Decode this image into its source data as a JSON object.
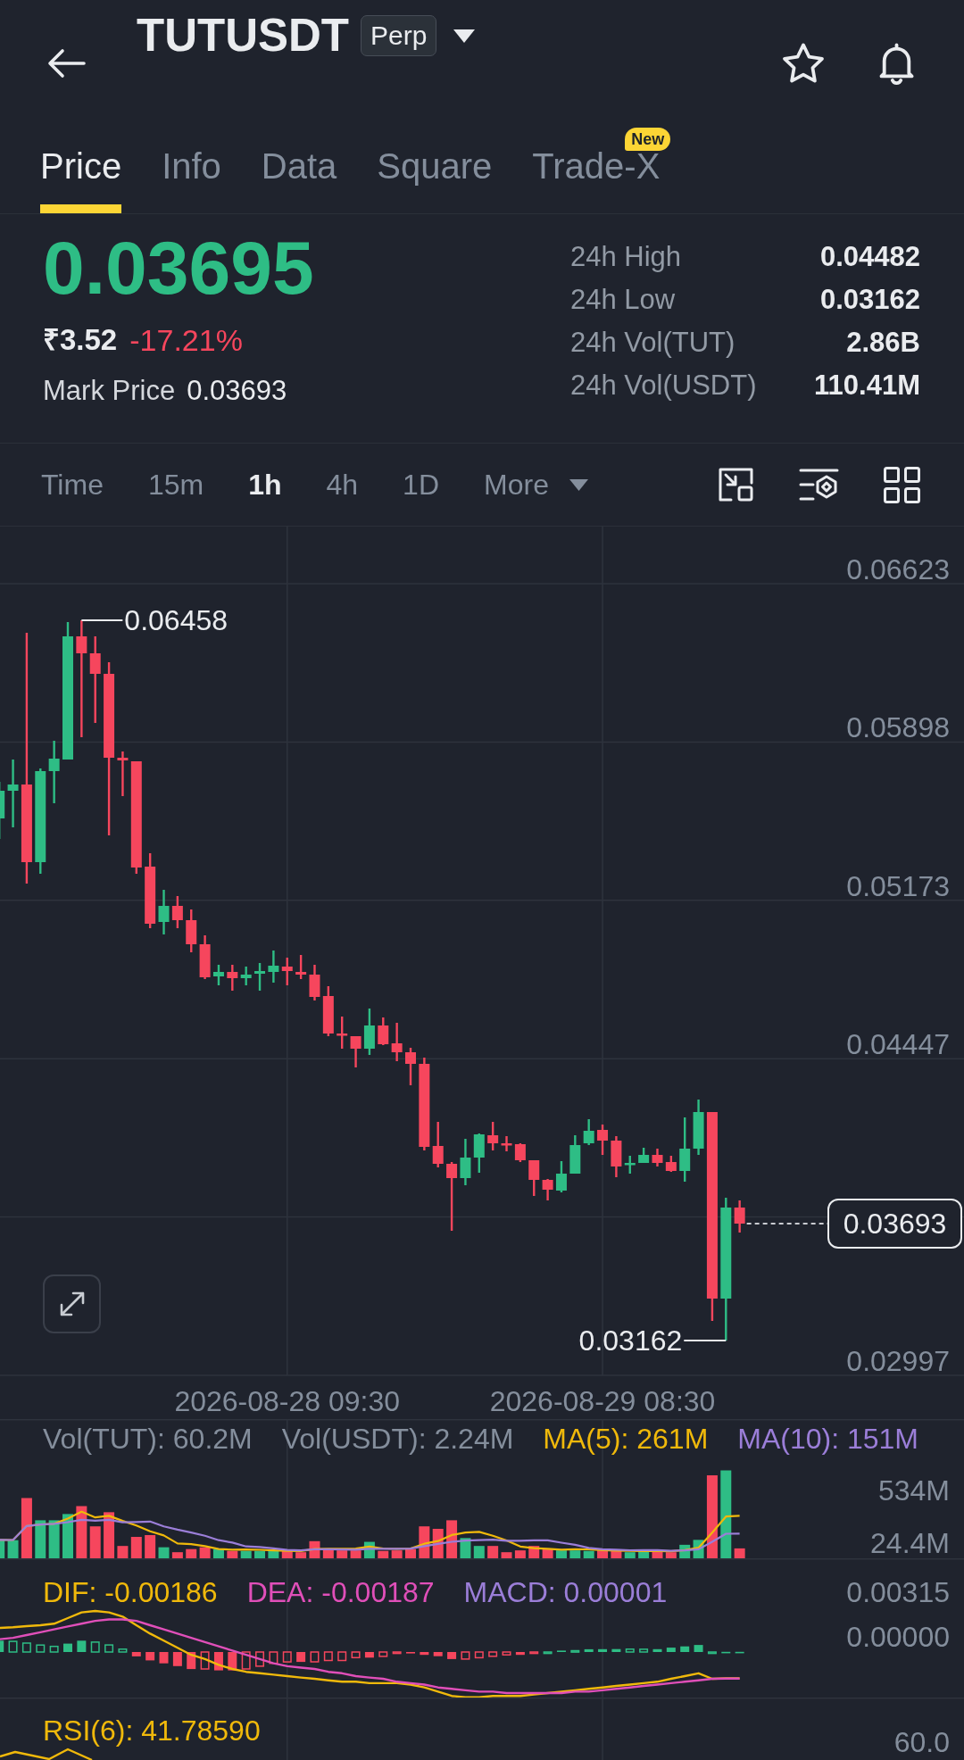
{
  "header": {
    "symbol": "TUTUSDT",
    "contract": "Perp",
    "favorite": false
  },
  "tabs": [
    {
      "label": "Price",
      "selected": true
    },
    {
      "label": "Info",
      "selected": false
    },
    {
      "label": "Data",
      "selected": false
    },
    {
      "label": "Square",
      "selected": false
    },
    {
      "label": "Trade-X",
      "selected": false,
      "badge": "New"
    }
  ],
  "ticker": {
    "last_price": "0.03695",
    "last_price_up": true,
    "fiat_price": "₹3.52",
    "change": "-17.21%",
    "change_up": false,
    "mark_price_label": "Mark Price",
    "mark_price": "0.03693",
    "stats": [
      {
        "label": "24h High",
        "value": "0.04482"
      },
      {
        "label": "24h Low",
        "value": "0.03162"
      },
      {
        "label": "24h Vol(TUT)",
        "value": "2.86B"
      },
      {
        "label": "24h Vol(USDT)",
        "value": "110.41M"
      }
    ]
  },
  "toolbar": {
    "intervals": [
      {
        "label": "Time",
        "selected": false
      },
      {
        "label": "15m",
        "selected": false
      },
      {
        "label": "1h",
        "selected": true
      },
      {
        "label": "4h",
        "selected": false
      },
      {
        "label": "1D",
        "selected": false
      }
    ],
    "more": "More"
  },
  "price_chart": {
    "price_axis": [
      "0.06623",
      "0.05898",
      "0.05173",
      "0.04447",
      "0.02997"
    ],
    "time_axis": [
      "2026-08-28 09:30",
      "2026-08-29 08:30"
    ],
    "high_label": "0.06458",
    "low_label": "0.03162",
    "last_price_tag": "0.03693"
  },
  "volume": {
    "legend": [
      {
        "label": "Vol(TUT): 60.2M",
        "color": "#848e9c"
      },
      {
        "label": "Vol(USDT): 2.24M",
        "color": "#848e9c"
      },
      {
        "label": "MA(5): 261M",
        "color": "#f0b90b"
      },
      {
        "label": "MA(10): 151M",
        "color": "#9b7ed8"
      }
    ],
    "scale_labels": [
      "534M",
      "24.4M"
    ]
  },
  "macd": {
    "legend": [
      {
        "label": "DIF: -0.00186",
        "color": "#f0b90b"
      },
      {
        "label": "DEA: -0.00187",
        "color": "#e04fb9"
      },
      {
        "label": "MACD: 0.00001",
        "color": "#9b7ed8"
      }
    ],
    "scale_labels": [
      "0.00315",
      "0.00000"
    ]
  },
  "rsi": {
    "legend": [
      {
        "label": "RSI(6): 41.78590",
        "color": "#f0b90b"
      }
    ],
    "axis_label": "60.0"
  }
}
